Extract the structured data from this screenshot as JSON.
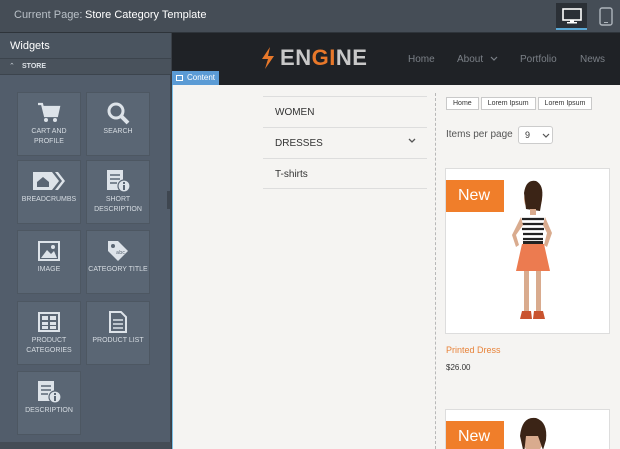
{
  "topbar": {
    "label": "Current Page:",
    "value": "Store Category Template",
    "device_desktop_icon": "desktop-icon",
    "device_tablet_icon": "tablet-icon"
  },
  "sidebar": {
    "title": "Widgets",
    "category": "STORE",
    "widgets": [
      {
        "label": "CART AND PROFILE",
        "icon": "cart-icon"
      },
      {
        "label": "SEARCH",
        "icon": "search-icon"
      },
      {
        "label": "BREADCRUMBS",
        "icon": "breadcrumbs-icon"
      },
      {
        "label": "SHORT DESCRIPTION",
        "icon": "short-description-icon"
      },
      {
        "label": "IMAGE",
        "icon": "image-icon"
      },
      {
        "label": "CATEGORY TITLE",
        "icon": "tag-icon"
      },
      {
        "label": "PRODUCT CATEGORIES",
        "icon": "grid-icon"
      },
      {
        "label": "PRODUCT LIST",
        "icon": "list-doc-icon"
      },
      {
        "label": "DESCRIPTION",
        "icon": "description-icon"
      }
    ]
  },
  "site": {
    "logo_text": "ENGINE",
    "menu": [
      "Home",
      "About",
      "Portfolio",
      "News"
    ],
    "content_tag": "Content"
  },
  "categories": [
    "WOMEN",
    "DRESSES",
    "T-shirts"
  ],
  "breadcrumbs": [
    "Home",
    "Lorem Ipsum",
    "Lorem Ipsum"
  ],
  "items_per_page": {
    "label": "Items per page",
    "value": "9"
  },
  "products": [
    {
      "badge": "New",
      "name": "Printed Dress",
      "price": "$26.00"
    },
    {
      "badge": "New"
    }
  ],
  "colors": {
    "accent": "#f07e2a",
    "sidebar": "#525d6b",
    "highlight": "#5b9bd5"
  }
}
